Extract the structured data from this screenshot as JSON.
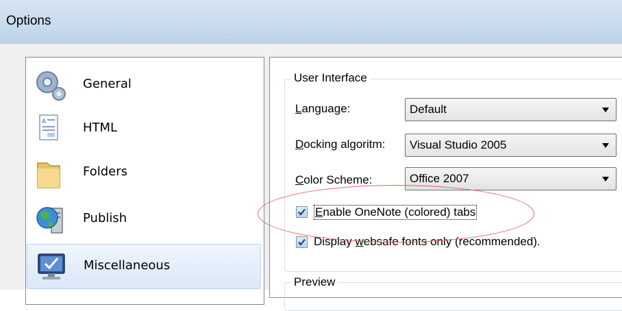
{
  "window": {
    "title": "Options"
  },
  "nav": {
    "items": [
      {
        "label": "General",
        "icon": "gears-icon"
      },
      {
        "label": "HTML",
        "icon": "html-document-icon"
      },
      {
        "label": "Folders",
        "icon": "folder-icon"
      },
      {
        "label": "Publish",
        "icon": "globe-server-icon"
      },
      {
        "label": "Miscellaneous",
        "icon": "computer-monitor-icon",
        "selected": true
      }
    ]
  },
  "user_interface": {
    "title": "User Interface",
    "language": {
      "label_pre": "",
      "label_acc": "L",
      "label_post": "anguage:",
      "value": "Default"
    },
    "docking": {
      "label_pre": "",
      "label_acc": "D",
      "label_post": "ocking algoritm:",
      "value": "Visual Studio 2005"
    },
    "color_scheme": {
      "label_pre": "",
      "label_acc": "C",
      "label_post": "olor Scheme:",
      "value": "Office 2007"
    },
    "onenote_tabs": {
      "label_pre": "",
      "label_acc": "E",
      "label_post": "nable OneNote (colored) tabs",
      "checked": true
    },
    "websafe_fonts": {
      "label_pre": "Display ",
      "label_acc": "w",
      "label_post": "ebsafe fonts only (recommended).",
      "checked": true
    }
  },
  "preview": {
    "title": "Preview"
  },
  "colors": {
    "annotation": "#e06060",
    "selection": "#dbe8f8",
    "check": "#1c3f94"
  }
}
